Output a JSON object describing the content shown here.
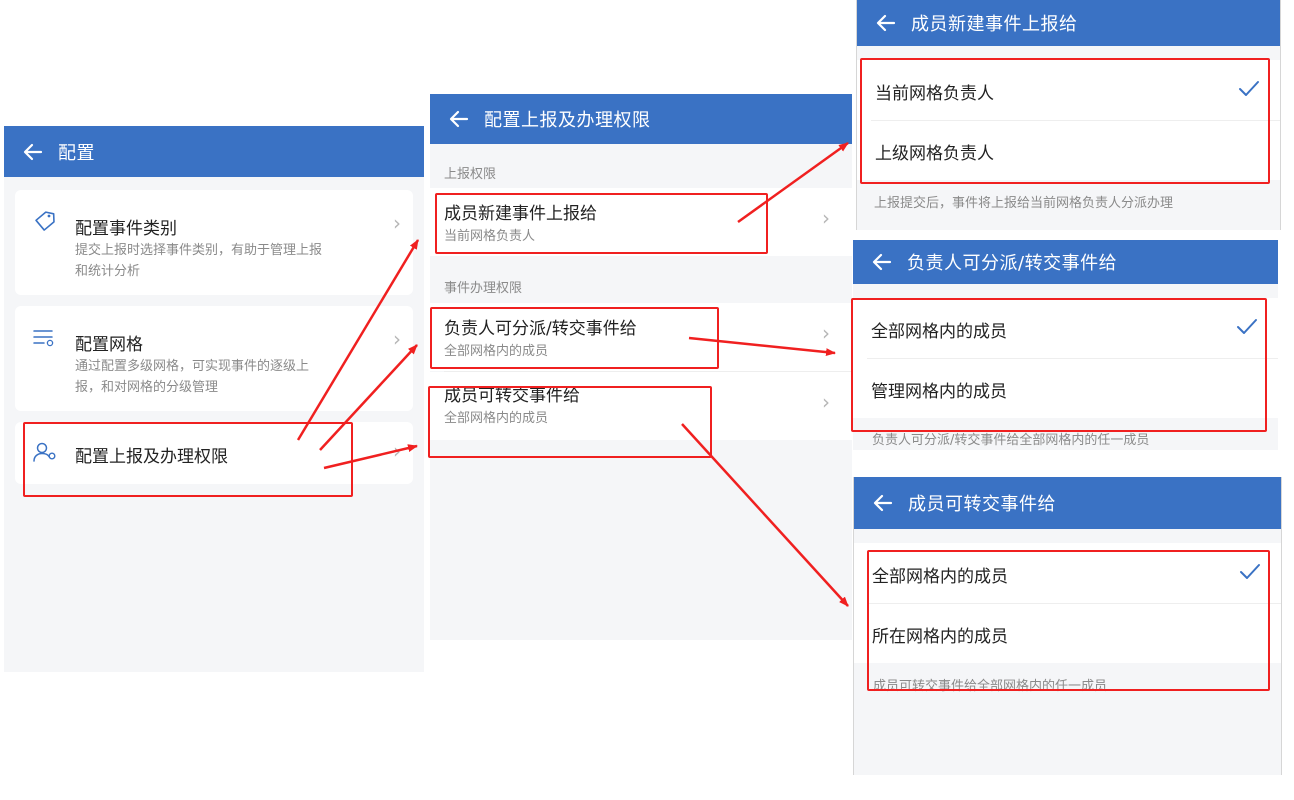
{
  "screen1": {
    "title": "配置",
    "items": [
      {
        "title": "配置事件类别",
        "subtitle_line1": "提交上报时选择事件类别，有助于管理上报",
        "subtitle_line2": "和统计分析",
        "icon": "tag-icon"
      },
      {
        "title": "配置网格",
        "subtitle_line1": "通过配置多级网格，可实现事件的逐级上",
        "subtitle_line2": "报，和对网格的分级管理",
        "icon": "grid-list-icon"
      },
      {
        "title": "配置上报及办理权限",
        "icon": "user-gear-icon"
      }
    ]
  },
  "screen2": {
    "title": "配置上报及办理权限",
    "section1": "上报权限",
    "row1": {
      "title": "成员新建事件上报给",
      "value": "当前网格负责人"
    },
    "section2": "事件办理权限",
    "row2": {
      "title": "负责人可分派/转交事件给",
      "value": "全部网格内的成员"
    },
    "row3": {
      "title": "成员可转交事件给",
      "value": "全部网格内的成员"
    }
  },
  "screen3a": {
    "title": "成员新建事件上报给",
    "options": [
      "当前网格负责人",
      "上级网格负责人"
    ],
    "selected_index": 0,
    "note": "上报提交后，事件将上报给当前网格负责人分派办理"
  },
  "screen3b": {
    "title": "负责人可分派/转交事件给",
    "options": [
      "全部网格内的成员",
      "管理网格内的成员"
    ],
    "selected_index": 0,
    "note": "负责人可分派/转交事件给全部网格内的任一成员"
  },
  "screen3c": {
    "title": "成员可转交事件给",
    "options": [
      "全部网格内的成员",
      "所在网格内的成员"
    ],
    "selected_index": 0,
    "note": "成员可转交事件给全部网格内的任一成员"
  },
  "colors": {
    "header_blue": "#3a72c4",
    "annotation_red": "#f02020",
    "check_blue": "#3a72c4",
    "background": "#f5f6f8"
  }
}
